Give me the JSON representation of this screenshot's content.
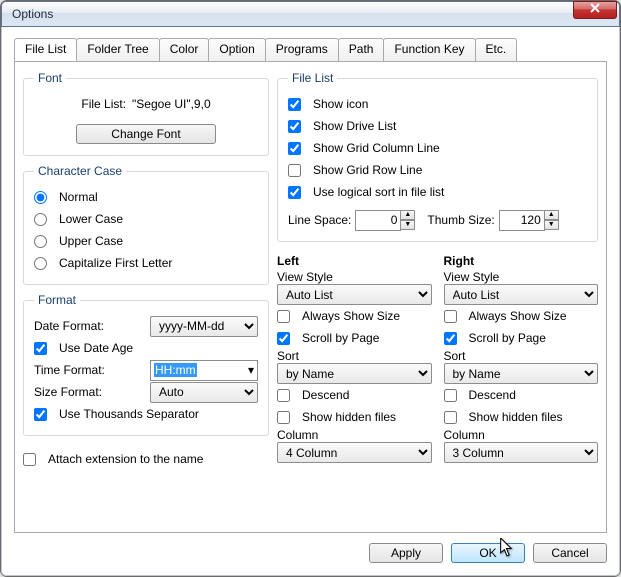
{
  "window": {
    "title": "Options"
  },
  "tabs": [
    "File List",
    "Folder Tree",
    "Color",
    "Option",
    "Programs",
    "Path",
    "Function Key",
    "Etc."
  ],
  "activeTab": 0,
  "font": {
    "legend": "Font",
    "label": "File List:",
    "value": "\"Segoe UI\",9,0",
    "button": "Change Font"
  },
  "charCase": {
    "legend": "Character Case",
    "options": [
      "Normal",
      "Lower Case",
      "Upper Case",
      "Capitalize First Letter"
    ],
    "selected": 0
  },
  "format": {
    "legend": "Format",
    "dateLabel": "Date Format:",
    "dateValue": "yyyy-MM-dd",
    "useDateAge": "Use Date Age",
    "useDateAgeChecked": true,
    "timeLabel": "Time Format:",
    "timeValue": "HH:mm",
    "sizeLabel": "Size Format:",
    "sizeValue": "Auto",
    "useThousands": "Use Thousands Separator",
    "useThousandsChecked": true,
    "attachExt": "Attach extension to the name",
    "attachExtChecked": false
  },
  "fileList": {
    "legend": "File List",
    "items": [
      {
        "label": "Show icon",
        "checked": true
      },
      {
        "label": "Show Drive List",
        "checked": true
      },
      {
        "label": "Show Grid Column Line",
        "checked": true
      },
      {
        "label": "Show Grid Row Line",
        "checked": false
      },
      {
        "label": "Use logical sort in file list",
        "checked": true
      }
    ],
    "lineSpaceLabel": "Line Space:",
    "lineSpaceValue": "0",
    "thumbSizeLabel": "Thumb Size:",
    "thumbSizeValue": "120"
  },
  "panes": {
    "left": {
      "title": "Left",
      "viewStyleLabel": "View Style",
      "viewStyle": "Auto List",
      "alwaysShowSize": "Always Show Size",
      "alwaysShowSizeChecked": false,
      "scrollByPage": "Scroll by Page",
      "scrollByPageChecked": true,
      "sortLabel": "Sort",
      "sort": "by Name",
      "descend": "Descend",
      "descendChecked": false,
      "showHidden": "Show hidden files",
      "showHiddenChecked": false,
      "columnLabel": "Column",
      "column": "4 Column"
    },
    "right": {
      "title": "Right",
      "viewStyleLabel": "View Style",
      "viewStyle": "Auto List",
      "alwaysShowSize": "Always Show Size",
      "alwaysShowSizeChecked": false,
      "scrollByPage": "Scroll by Page",
      "scrollByPageChecked": true,
      "sortLabel": "Sort",
      "sort": "by Name",
      "descend": "Descend",
      "descendChecked": false,
      "showHidden": "Show hidden files",
      "showHiddenChecked": false,
      "columnLabel": "Column",
      "column": "3 Column"
    }
  },
  "buttons": {
    "apply": "Apply",
    "ok": "OK",
    "cancel": "Cancel"
  }
}
